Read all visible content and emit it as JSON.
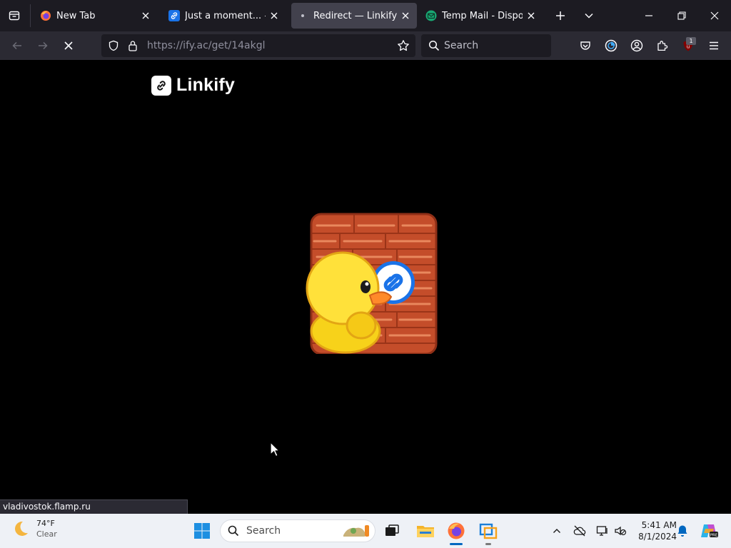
{
  "browser": {
    "tabs": [
      {
        "title": "New Tab",
        "favicon": "firefox-icon",
        "active": false
      },
      {
        "title": "Just a moment... — Linkify",
        "favicon": "linkify-icon",
        "active": false
      },
      {
        "title": "Redirect — Linkify",
        "favicon": "loading-dot-icon",
        "active": true
      },
      {
        "title": "Temp Mail - Disposable Temporary Email",
        "favicon": "tempmail-icon",
        "active": false
      }
    ],
    "url": "https://ify.ac/get/14akgl",
    "search_placeholder": "Search",
    "extension_badge": "1",
    "status_url": "vladivostok.flamp.ru"
  },
  "page": {
    "brand_name": "Linkify",
    "accent": "#1a73e8"
  },
  "taskbar": {
    "weather_temp": "74°F",
    "weather_desc": "Clear",
    "search_placeholder": "Search",
    "time": "5:41 AM",
    "date": "8/1/2024"
  }
}
